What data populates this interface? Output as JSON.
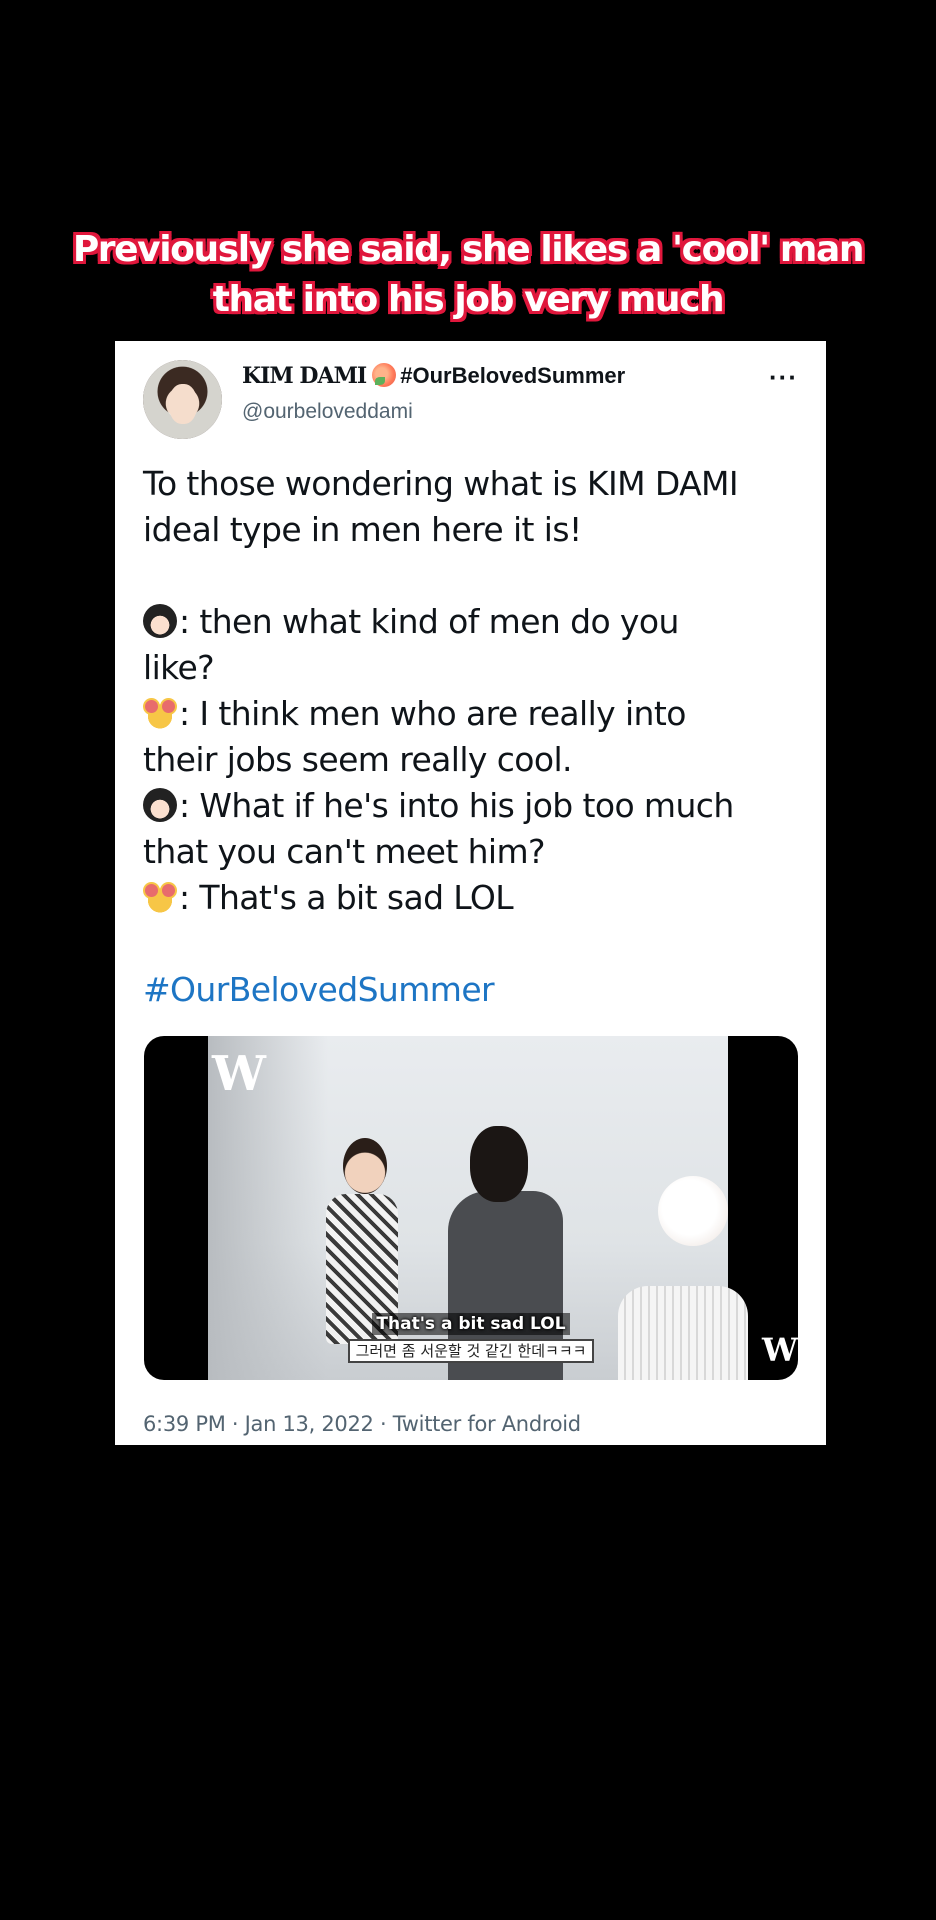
{
  "caption": {
    "line1": "Previously she said, she likes a 'cool' man",
    "line2": "that into his job very much"
  },
  "tweet": {
    "display_name": "KIM DAMI",
    "name_emoji": "peach-icon",
    "display_hashtag": "#OurBelovedSummer",
    "handle": "@ourbeloveddami",
    "more_label": "···",
    "intro_line1": "To those wondering what is KIM DAMI",
    "intro_line2": "ideal type in men here it is!",
    "q1": ": then what kind of men do you",
    "q1_cont": "like?",
    "a1": ": I think men who are really into",
    "a1_cont": "their jobs seem really cool.",
    "q2": ": What if he's into his job too much",
    "q2_cont": "that you can't meet him?",
    "a2": ": That's a bit sad LOL",
    "hashtag": "#OurBelovedSummer",
    "timestamp": "6:39 PM · Jan 13, 2022 · Twitter for Android"
  },
  "media": {
    "logo": "W",
    "subtitle_en": "That's a bit sad LOL",
    "subtitle_ko": "그러면 좀 서운할 것 같긴 한데ㅋㅋㅋ"
  }
}
